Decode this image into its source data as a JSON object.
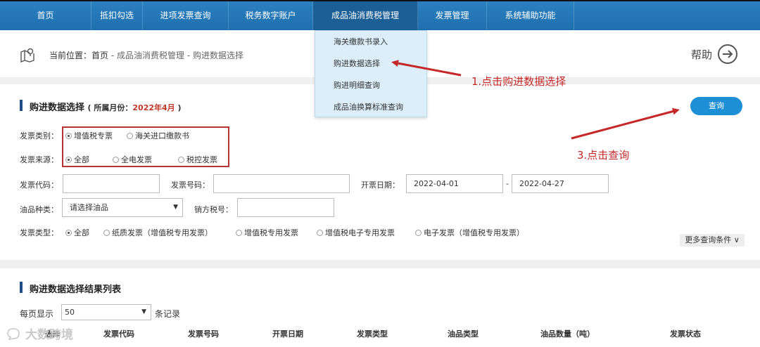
{
  "nav": {
    "items": [
      "首页",
      "抵扣勾选",
      "进项发票查询",
      "税务数字账户",
      "成品油消费税管理",
      "发票管理",
      "系统辅助功能"
    ],
    "active_index": 4
  },
  "breadcrumb": {
    "label": "当前位置：",
    "home": "首页",
    "path": " - 成品油消费税管理 - 购进数据选择"
  },
  "help_label": "帮助",
  "dropdown": {
    "items": [
      "海关缴款书录入",
      "购进数据选择",
      "购进明细查询",
      "成品油换算标准查询"
    ]
  },
  "query": {
    "title": "购进数据选择",
    "sub_prefix": "( 所属月份：",
    "month": "2022年4月",
    "sub_suffix": " )",
    "button": "查询",
    "invoice_category_label": "发票类别：",
    "invoice_category_options": [
      "增值税专票",
      "海关进口缴款书"
    ],
    "invoice_source_label": "发票来源：",
    "invoice_source_options": [
      "全部",
      "全电发票",
      "税控发票"
    ],
    "invoice_code_label": "发票代码：",
    "invoice_number_label": "发票号码：",
    "issue_date_label": "开票日期：",
    "date_from": "2022-04-01",
    "date_sep": "-",
    "date_to": "2022-04-27",
    "oil_type_label": "油品种类：",
    "oil_type_value": "请选择油品",
    "seller_tax_label": "销方税号：",
    "invoice_type_label": "发票类型：",
    "invoice_type_options": [
      "全部",
      "纸质发票（增值税专用发票）",
      "增值税专用发票",
      "增值税电子专用发票",
      "电子发票（增值税专用发票）"
    ],
    "more_conditions": "更多查询条件 ∨"
  },
  "results": {
    "title": "购进数据选择结果列表",
    "per_page_label": "每页显示",
    "per_page_value": "50",
    "per_page_suffix": "条记录",
    "columns": [
      "选择",
      "发票代码",
      "发票号码",
      "开票日期",
      "发票类型",
      "油品类型",
      "油品数量（吨）",
      "发票状态"
    ]
  },
  "annotations": {
    "step1": "1.点击购进数据选择",
    "step3": "3.点击查询"
  },
  "watermark": "大数跨境",
  "colors": {
    "nav": "#1f6fae",
    "accent": "#1d8fd6",
    "annotation": "#c62828"
  }
}
